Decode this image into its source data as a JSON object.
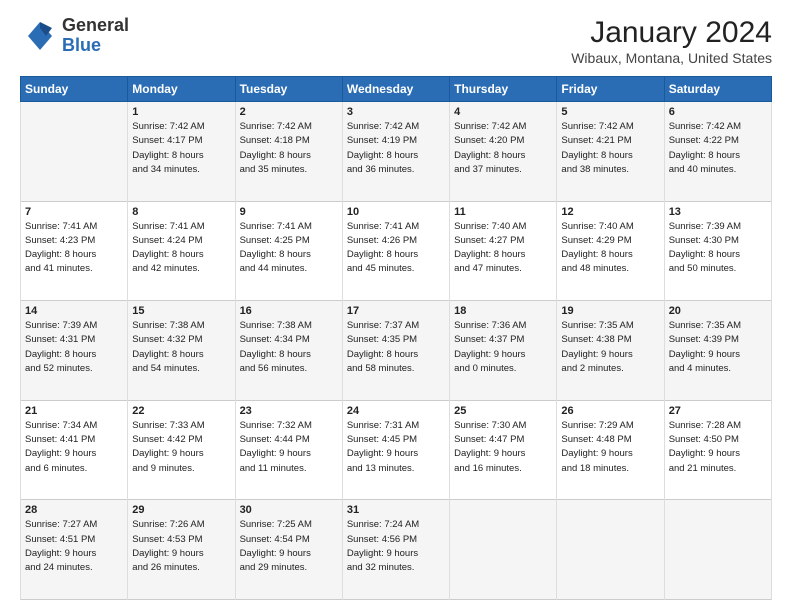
{
  "logo": {
    "general": "General",
    "blue": "Blue"
  },
  "header": {
    "month_year": "January 2024",
    "location": "Wibaux, Montana, United States"
  },
  "columns": [
    "Sunday",
    "Monday",
    "Tuesday",
    "Wednesday",
    "Thursday",
    "Friday",
    "Saturday"
  ],
  "weeks": [
    [
      {
        "day": "",
        "sunrise": "",
        "sunset": "",
        "daylight": ""
      },
      {
        "day": "1",
        "sunrise": "Sunrise: 7:42 AM",
        "sunset": "Sunset: 4:17 PM",
        "daylight": "Daylight: 8 hours and 34 minutes."
      },
      {
        "day": "2",
        "sunrise": "Sunrise: 7:42 AM",
        "sunset": "Sunset: 4:18 PM",
        "daylight": "Daylight: 8 hours and 35 minutes."
      },
      {
        "day": "3",
        "sunrise": "Sunrise: 7:42 AM",
        "sunset": "Sunset: 4:19 PM",
        "daylight": "Daylight: 8 hours and 36 minutes."
      },
      {
        "day": "4",
        "sunrise": "Sunrise: 7:42 AM",
        "sunset": "Sunset: 4:20 PM",
        "daylight": "Daylight: 8 hours and 37 minutes."
      },
      {
        "day": "5",
        "sunrise": "Sunrise: 7:42 AM",
        "sunset": "Sunset: 4:21 PM",
        "daylight": "Daylight: 8 hours and 38 minutes."
      },
      {
        "day": "6",
        "sunrise": "Sunrise: 7:42 AM",
        "sunset": "Sunset: 4:22 PM",
        "daylight": "Daylight: 8 hours and 40 minutes."
      }
    ],
    [
      {
        "day": "7",
        "sunrise": "Sunrise: 7:41 AM",
        "sunset": "Sunset: 4:23 PM",
        "daylight": "Daylight: 8 hours and 41 minutes."
      },
      {
        "day": "8",
        "sunrise": "Sunrise: 7:41 AM",
        "sunset": "Sunset: 4:24 PM",
        "daylight": "Daylight: 8 hours and 42 minutes."
      },
      {
        "day": "9",
        "sunrise": "Sunrise: 7:41 AM",
        "sunset": "Sunset: 4:25 PM",
        "daylight": "Daylight: 8 hours and 44 minutes."
      },
      {
        "day": "10",
        "sunrise": "Sunrise: 7:41 AM",
        "sunset": "Sunset: 4:26 PM",
        "daylight": "Daylight: 8 hours and 45 minutes."
      },
      {
        "day": "11",
        "sunrise": "Sunrise: 7:40 AM",
        "sunset": "Sunset: 4:27 PM",
        "daylight": "Daylight: 8 hours and 47 minutes."
      },
      {
        "day": "12",
        "sunrise": "Sunrise: 7:40 AM",
        "sunset": "Sunset: 4:29 PM",
        "daylight": "Daylight: 8 hours and 48 minutes."
      },
      {
        "day": "13",
        "sunrise": "Sunrise: 7:39 AM",
        "sunset": "Sunset: 4:30 PM",
        "daylight": "Daylight: 8 hours and 50 minutes."
      }
    ],
    [
      {
        "day": "14",
        "sunrise": "Sunrise: 7:39 AM",
        "sunset": "Sunset: 4:31 PM",
        "daylight": "Daylight: 8 hours and 52 minutes."
      },
      {
        "day": "15",
        "sunrise": "Sunrise: 7:38 AM",
        "sunset": "Sunset: 4:32 PM",
        "daylight": "Daylight: 8 hours and 54 minutes."
      },
      {
        "day": "16",
        "sunrise": "Sunrise: 7:38 AM",
        "sunset": "Sunset: 4:34 PM",
        "daylight": "Daylight: 8 hours and 56 minutes."
      },
      {
        "day": "17",
        "sunrise": "Sunrise: 7:37 AM",
        "sunset": "Sunset: 4:35 PM",
        "daylight": "Daylight: 8 hours and 58 minutes."
      },
      {
        "day": "18",
        "sunrise": "Sunrise: 7:36 AM",
        "sunset": "Sunset: 4:37 PM",
        "daylight": "Daylight: 9 hours and 0 minutes."
      },
      {
        "day": "19",
        "sunrise": "Sunrise: 7:35 AM",
        "sunset": "Sunset: 4:38 PM",
        "daylight": "Daylight: 9 hours and 2 minutes."
      },
      {
        "day": "20",
        "sunrise": "Sunrise: 7:35 AM",
        "sunset": "Sunset: 4:39 PM",
        "daylight": "Daylight: 9 hours and 4 minutes."
      }
    ],
    [
      {
        "day": "21",
        "sunrise": "Sunrise: 7:34 AM",
        "sunset": "Sunset: 4:41 PM",
        "daylight": "Daylight: 9 hours and 6 minutes."
      },
      {
        "day": "22",
        "sunrise": "Sunrise: 7:33 AM",
        "sunset": "Sunset: 4:42 PM",
        "daylight": "Daylight: 9 hours and 9 minutes."
      },
      {
        "day": "23",
        "sunrise": "Sunrise: 7:32 AM",
        "sunset": "Sunset: 4:44 PM",
        "daylight": "Daylight: 9 hours and 11 minutes."
      },
      {
        "day": "24",
        "sunrise": "Sunrise: 7:31 AM",
        "sunset": "Sunset: 4:45 PM",
        "daylight": "Daylight: 9 hours and 13 minutes."
      },
      {
        "day": "25",
        "sunrise": "Sunrise: 7:30 AM",
        "sunset": "Sunset: 4:47 PM",
        "daylight": "Daylight: 9 hours and 16 minutes."
      },
      {
        "day": "26",
        "sunrise": "Sunrise: 7:29 AM",
        "sunset": "Sunset: 4:48 PM",
        "daylight": "Daylight: 9 hours and 18 minutes."
      },
      {
        "day": "27",
        "sunrise": "Sunrise: 7:28 AM",
        "sunset": "Sunset: 4:50 PM",
        "daylight": "Daylight: 9 hours and 21 minutes."
      }
    ],
    [
      {
        "day": "28",
        "sunrise": "Sunrise: 7:27 AM",
        "sunset": "Sunset: 4:51 PM",
        "daylight": "Daylight: 9 hours and 24 minutes."
      },
      {
        "day": "29",
        "sunrise": "Sunrise: 7:26 AM",
        "sunset": "Sunset: 4:53 PM",
        "daylight": "Daylight: 9 hours and 26 minutes."
      },
      {
        "day": "30",
        "sunrise": "Sunrise: 7:25 AM",
        "sunset": "Sunset: 4:54 PM",
        "daylight": "Daylight: 9 hours and 29 minutes."
      },
      {
        "day": "31",
        "sunrise": "Sunrise: 7:24 AM",
        "sunset": "Sunset: 4:56 PM",
        "daylight": "Daylight: 9 hours and 32 minutes."
      },
      {
        "day": "",
        "sunrise": "",
        "sunset": "",
        "daylight": ""
      },
      {
        "day": "",
        "sunrise": "",
        "sunset": "",
        "daylight": ""
      },
      {
        "day": "",
        "sunrise": "",
        "sunset": "",
        "daylight": ""
      }
    ]
  ]
}
